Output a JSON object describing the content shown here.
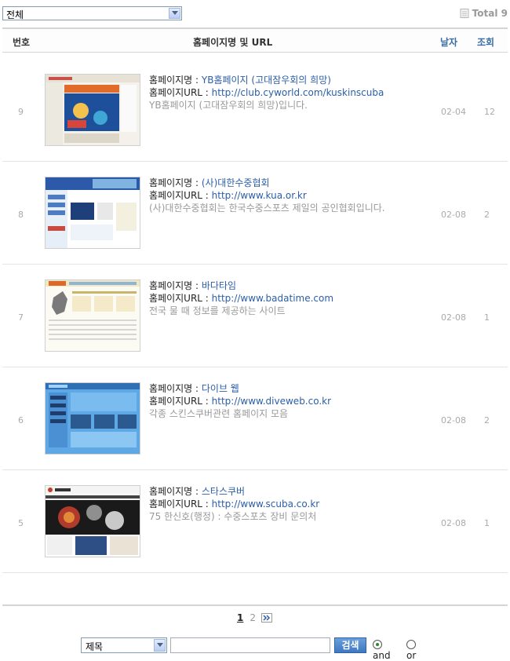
{
  "filter": {
    "selected": "전체"
  },
  "total": {
    "label": "Total",
    "count": "9"
  },
  "header": {
    "num": "번호",
    "name": "홈페이지명 및 URL",
    "date": "날자",
    "views": "조회"
  },
  "labels": {
    "name_prefix": "홈페이지명 : ",
    "url_prefix": "홈페이지URL : "
  },
  "rows": [
    {
      "num": "9",
      "name": "YB홈페이지 (고대잠우회의 희망)",
      "url": "http://club.cyworld.com/kuskinscuba",
      "desc": "YB홈페이지 (고대잠우회의 희망)입니다.",
      "date": "02-04",
      "views": "12"
    },
    {
      "num": "8",
      "name": "(사)대한수중협회",
      "url": "http://www.kua.or.kr",
      "desc": "(사)대한수중협회는 한국수중스포츠 제일의 공인협회입니다.",
      "date": "02-08",
      "views": "2"
    },
    {
      "num": "7",
      "name": "바다타임",
      "url": "http://www.badatime.com",
      "desc": "전국 물 때 정보를 제공하는 사이트",
      "date": "02-08",
      "views": "1"
    },
    {
      "num": "6",
      "name": "다이브 웹",
      "url": "http://www.diveweb.co.kr",
      "desc": "각종 스킨스쿠버관련 홈페이지 모음",
      "date": "02-08",
      "views": "2"
    },
    {
      "num": "5",
      "name": "스타스쿠버",
      "url": "http://www.scuba.co.kr",
      "desc": "75 한신호(행정) : 수중스포츠 장비 문의처",
      "date": "02-08",
      "views": "1"
    }
  ],
  "pager": {
    "current": "1",
    "next_page": "2"
  },
  "search": {
    "field": "제목",
    "button": "검색",
    "and_label": "and",
    "or_label": "or",
    "mode": "and"
  }
}
